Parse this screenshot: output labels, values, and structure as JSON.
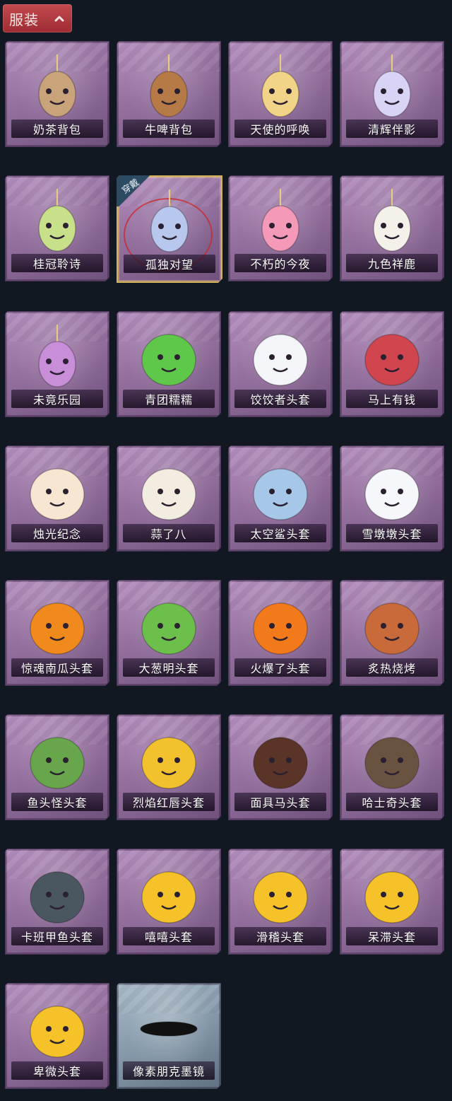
{
  "header": {
    "title": "服装",
    "chevron_icon": "chevron-up-icon"
  },
  "equipped_badge": "穿戴",
  "items": [
    {
      "label": "奶茶背包",
      "icon": "milk-tea-backpack-icon",
      "color": "#c9a37a"
    },
    {
      "label": "牛啤背包",
      "icon": "beer-barrel-backpack-icon",
      "color": "#b67a46"
    },
    {
      "label": "天使的呼唤",
      "icon": "angel-charm-icon",
      "color": "#f1d487"
    },
    {
      "label": "清辉伴影",
      "icon": "silver-hair-charm-icon",
      "color": "#d9d3f5"
    },
    {
      "label": "桂冠聆诗",
      "icon": "laurel-charm-icon",
      "color": "#c8e08a"
    },
    {
      "label": "孤独对望",
      "icon": "lonely-gaze-charm-icon",
      "color": "#b7c7ee",
      "equipped": true
    },
    {
      "label": "不朽的今夜",
      "icon": "pink-fox-charm-icon",
      "color": "#f49ab8"
    },
    {
      "label": "九色祥鹿",
      "icon": "white-deer-charm-icon",
      "color": "#f4f0ea"
    },
    {
      "label": "未竟乐园",
      "icon": "star-girl-charm-icon",
      "color": "#c88ed8"
    },
    {
      "label": "青团糯糯",
      "icon": "green-rice-ball-hood-icon",
      "color": "#5fc84a"
    },
    {
      "label": "饺饺者头套",
      "icon": "dumpling-hood-icon",
      "color": "#f3f5f8"
    },
    {
      "label": "马上有钱",
      "icon": "red-horse-hood-icon",
      "color": "#d1464e"
    },
    {
      "label": "烛光纪念",
      "icon": "candle-hood-icon",
      "color": "#f7e6d2"
    },
    {
      "label": "蒜了八",
      "icon": "garlic-hood-icon",
      "color": "#f3ece0"
    },
    {
      "label": "太空鲨头套",
      "icon": "shark-hood-icon",
      "color": "#a7c7e9"
    },
    {
      "label": "雪墩墩头套",
      "icon": "snowman-hood-icon",
      "color": "#f5f7fb"
    },
    {
      "label": "惊魂南瓜头套",
      "icon": "pumpkin-hood-icon",
      "color": "#f08a1c"
    },
    {
      "label": "大葱明头套",
      "icon": "green-onion-hood-icon",
      "color": "#6bbf4a"
    },
    {
      "label": "火爆了头套",
      "icon": "fire-hood-icon",
      "color": "#f27a1a"
    },
    {
      "label": "炙热烧烤",
      "icon": "bbq-meat-hood-icon",
      "color": "#c86a3a"
    },
    {
      "label": "鱼头怪头套",
      "icon": "fish-head-mask-icon",
      "color": "#67a64a"
    },
    {
      "label": "烈焰红唇头套",
      "icon": "yellow-mouse-mask-icon",
      "color": "#f2c12e"
    },
    {
      "label": "面具马头套",
      "icon": "horse-mask-icon",
      "color": "#5a3426"
    },
    {
      "label": "哈士奇头套",
      "icon": "husky-mask-icon",
      "color": "#6a5240"
    },
    {
      "label": "卡班甲鱼头套",
      "icon": "turtle-hood-icon",
      "color": "#4a5660"
    },
    {
      "label": "嘻嘻头套",
      "icon": "grin-emoji-hood-icon",
      "color": "#f6c22a"
    },
    {
      "label": "滑稽头套",
      "icon": "funny-emoji-hood-icon",
      "color": "#f6c22a"
    },
    {
      "label": "呆滞头套",
      "icon": "dazed-emoji-hood-icon",
      "color": "#f6c22a"
    },
    {
      "label": "卑微头套",
      "icon": "humble-emoji-hood-icon",
      "color": "#f6c22a"
    },
    {
      "label": "像素朋克墨镜",
      "icon": "pixel-sunglasses-icon",
      "color": "#111111",
      "silver": true
    }
  ]
}
